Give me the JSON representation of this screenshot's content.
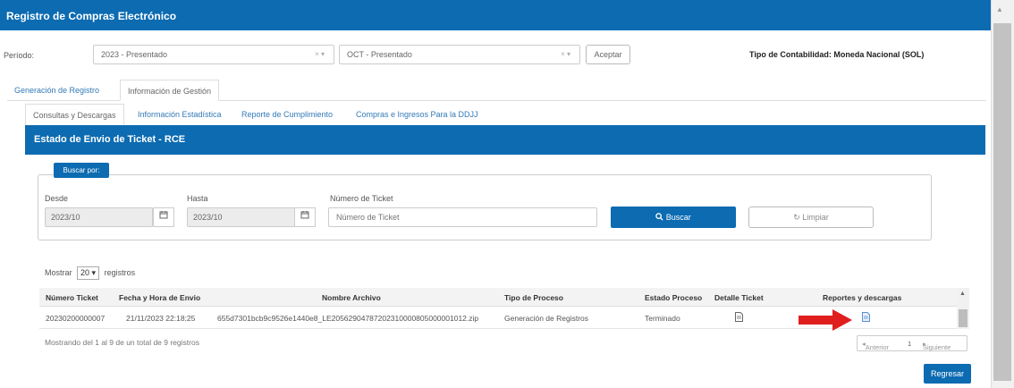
{
  "app": {
    "title": "Registro de Compras Electrónico"
  },
  "periodo": {
    "label": "Período:",
    "select1": "2023 - Presentado",
    "select2": "OCT - Presentado",
    "select_ctrl": "× ▾",
    "aceptar": "Aceptar",
    "tipo_contabilidad": "Tipo de Contabilidad: Moneda Nacional (SOL)"
  },
  "tabs_main": [
    "Generación de Registro",
    "Información de Gestión"
  ],
  "tabs_sub": [
    "Consultas y Descargas",
    "Información Estadística",
    "Reporte de Cumplimiento",
    "Compras e Ingresos Para la DDJJ"
  ],
  "panel": {
    "title": "Estado de Envio de Ticket - RCE"
  },
  "filter": {
    "buscar_por": "Buscar por:",
    "desde_label": "Desde",
    "desde_value": "2023/10",
    "hasta_label": "Hasta",
    "hasta_value": "2023/10",
    "ticket_label": "Número de Ticket",
    "ticket_placeholder": "Número de Ticket",
    "buscar": "Buscar",
    "limpiar": "Limpiar"
  },
  "table": {
    "mostrar": "Mostrar",
    "page_size": "20",
    "registros": "registros",
    "columns": [
      "Número Ticket",
      "Fecha y Hora de Envio",
      "Nombre Archivo",
      "Tipo de Proceso",
      "Estado Proceso",
      "Detalle Ticket",
      "Reportes y descargas"
    ],
    "rows": [
      [
        "20230200000007",
        "21/11/2023 22:18:25",
        "655d7301bcb9c9526e1440e8_LE20562904787202310000805000001012.zip",
        "Generación de Registros",
        "Terminado"
      ]
    ],
    "status": "Mostrando del 1 al 9 de un total de 9 registros",
    "pager": {
      "prev": "Anterior",
      "page": "1",
      "next": "Siguiente"
    }
  },
  "regresar": "Regresar",
  "colors": {
    "primary": "#0c6bb1",
    "arrow": "#e01e1e",
    "link": "#337ab7"
  },
  "icons": [
    "calendar-icon",
    "search-icon",
    "refresh-icon",
    "document-icon",
    "red-arrow-icon"
  ]
}
